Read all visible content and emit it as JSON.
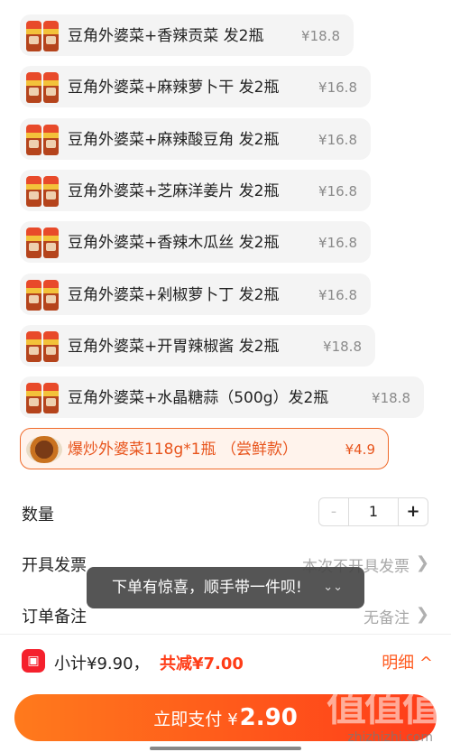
{
  "sku_options": [
    {
      "label": "豆角外婆菜+香辣贡菜 发2瓶",
      "price": "¥18.8",
      "thumb": "two-jars",
      "selected": false
    },
    {
      "label": "豆角外婆菜+麻辣萝卜干 发2瓶",
      "price": "¥16.8",
      "thumb": "two-jars",
      "selected": false
    },
    {
      "label": "豆角外婆菜+麻辣酸豆角 发2瓶",
      "price": "¥16.8",
      "thumb": "two-jars",
      "selected": false
    },
    {
      "label": "豆角外婆菜+芝麻洋姜片 发2瓶",
      "price": "¥16.8",
      "thumb": "two-jars",
      "selected": false
    },
    {
      "label": "豆角外婆菜+香辣木瓜丝 发2瓶",
      "price": "¥16.8",
      "thumb": "two-jars",
      "selected": false
    },
    {
      "label": "豆角外婆菜+剁椒萝卜丁 发2瓶",
      "price": "¥16.8",
      "thumb": "two-jars",
      "selected": false
    },
    {
      "label": "豆角外婆菜+开胃辣椒酱  发2瓶",
      "price": "¥18.8",
      "thumb": "two-jars",
      "selected": false
    },
    {
      "label": "豆角外婆菜+水晶糖蒜（500g）发2瓶",
      "price": "¥18.8",
      "thumb": "two-jars",
      "selected": false
    },
    {
      "label": "爆炒外婆菜118g*1瓶 （尝鲜款）",
      "price": "¥4.9",
      "thumb": "plate",
      "selected": true
    }
  ],
  "quantity": {
    "label": "数量",
    "minus": "-",
    "value": "1",
    "plus": "+"
  },
  "invoice": {
    "label": "开具发票",
    "value": "本次不开具发票"
  },
  "note": {
    "label": "订单备注",
    "value": "无备注"
  },
  "toast": {
    "text": "下单有惊喜，顺手带一件呗!",
    "icon": "double-chevron-down-icon"
  },
  "summary": {
    "subtotal": "小计¥9.90，",
    "discount": "共减¥7.00",
    "detail_label": "明细 ^"
  },
  "pay": {
    "label": "立即支付",
    "currency": "¥",
    "amount": "2.90"
  },
  "watermark": {
    "text": "值值值",
    "site": "zhizhizhi.com"
  },
  "colors": {
    "accent": "#ff5a1f",
    "selected_border": "#f06a2a",
    "discount": "#ff3d18",
    "coupon": "#f5212d"
  }
}
